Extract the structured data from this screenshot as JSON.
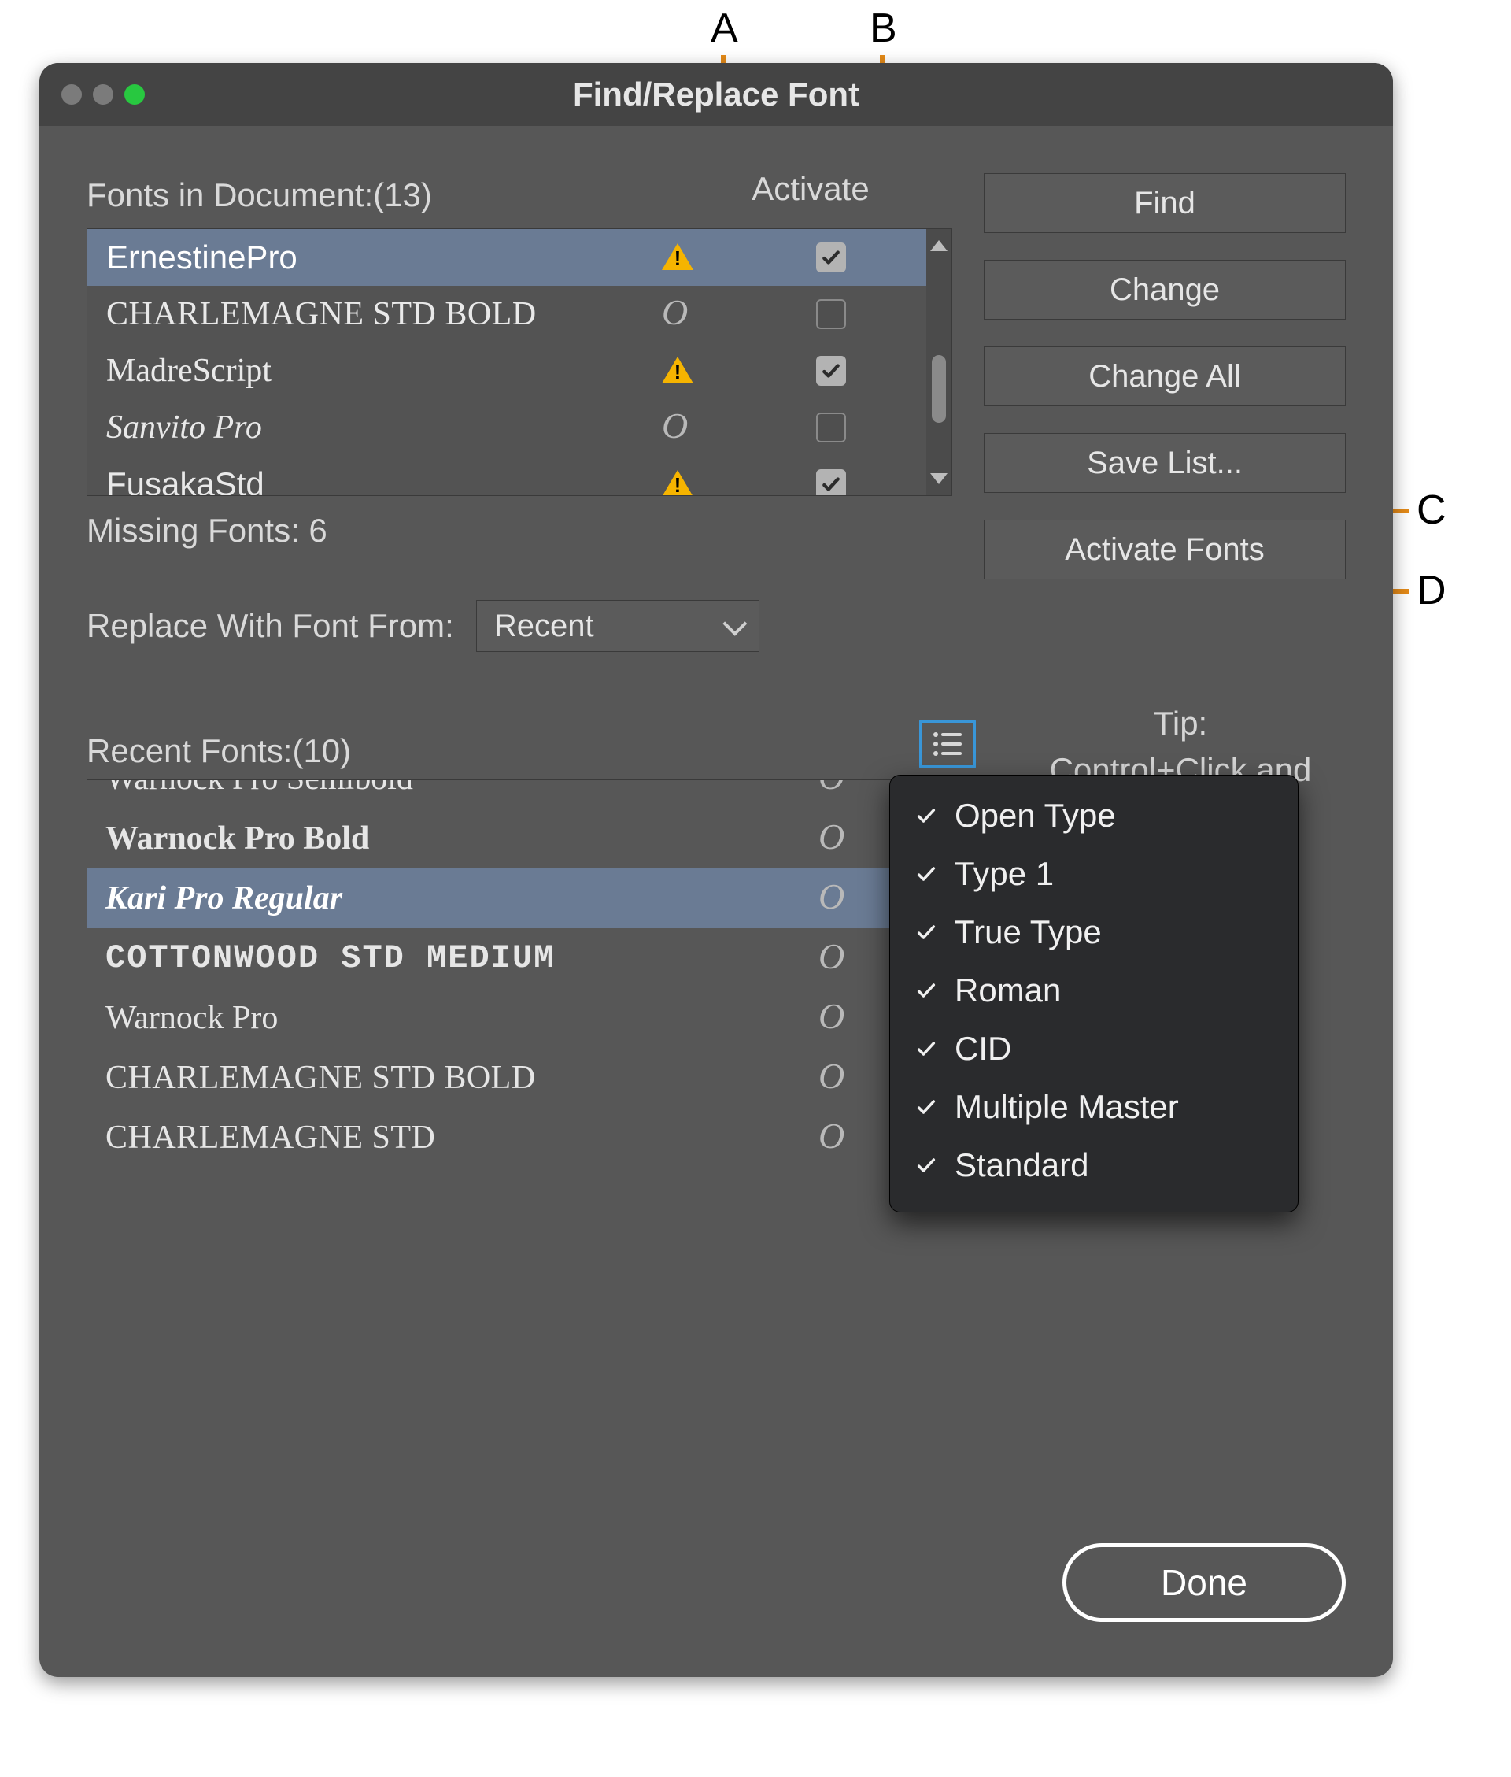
{
  "window": {
    "title": "Find/Replace Font"
  },
  "labels": {
    "fonts_in_document": "Fonts in Document:(13)",
    "activate_header": "Activate",
    "missing_fonts": "Missing Fonts: 6",
    "replace_with": "Replace With Font From:",
    "recent_fonts": "Recent Fonts:(10)",
    "tip_title": "Tip:",
    "tip_body": "Control+Click and"
  },
  "buttons": {
    "find": "Find",
    "change": "Change",
    "change_all": "Change All",
    "save_list": "Save List...",
    "activate_fonts": "Activate Fonts",
    "done": "Done"
  },
  "replace_select": {
    "value": "Recent"
  },
  "doc_fonts": [
    {
      "name": "ErnestinePro",
      "class": "font-ernestine",
      "status": "warn",
      "checked": true,
      "selected": true
    },
    {
      "name": "CHARLEMAGNE STD BOLD",
      "class": "font-charlemagne",
      "status": "otype",
      "checked": false,
      "selected": false
    },
    {
      "name": "MadreScript",
      "class": "font-madre",
      "status": "warn",
      "checked": true,
      "selected": false
    },
    {
      "name": "Sanvito Pro",
      "class": "font-sanvito",
      "status": "otype",
      "checked": false,
      "selected": false
    },
    {
      "name": "FusakaStd",
      "class": "font-fusaka",
      "status": "warn",
      "checked": true,
      "selected": false
    }
  ],
  "recent_fonts": [
    {
      "name": "Warnock Pro Semibold",
      "class": "font-warnock",
      "selected": false,
      "glyph": "otype",
      "cut": true
    },
    {
      "name": "Warnock Pro Bold",
      "class": "font-warnock-bold",
      "selected": false,
      "glyph": "otype"
    },
    {
      "name": "Kari Pro Regular",
      "class": "font-kari",
      "selected": true,
      "glyph": "otype"
    },
    {
      "name": "COTTONWOOD STD MEDIUM",
      "class": "font-cottonwood",
      "selected": false,
      "glyph": "otype"
    },
    {
      "name": "Warnock Pro",
      "class": "font-warnock",
      "selected": false,
      "glyph": "otype"
    },
    {
      "name": "CHARLEMAGNE STD BOLD",
      "class": "font-charlemagne",
      "selected": false,
      "glyph": "otype"
    },
    {
      "name": "CHARLEMAGNE STD",
      "class": "font-charlemagne",
      "selected": false,
      "glyph": "otype"
    }
  ],
  "filter_menu": [
    "Open Type",
    "Type 1",
    "True Type",
    "Roman",
    "CID",
    "Multiple Master",
    "Standard"
  ],
  "callouts": {
    "A": "A",
    "B": "B",
    "C": "C",
    "D": "D"
  }
}
